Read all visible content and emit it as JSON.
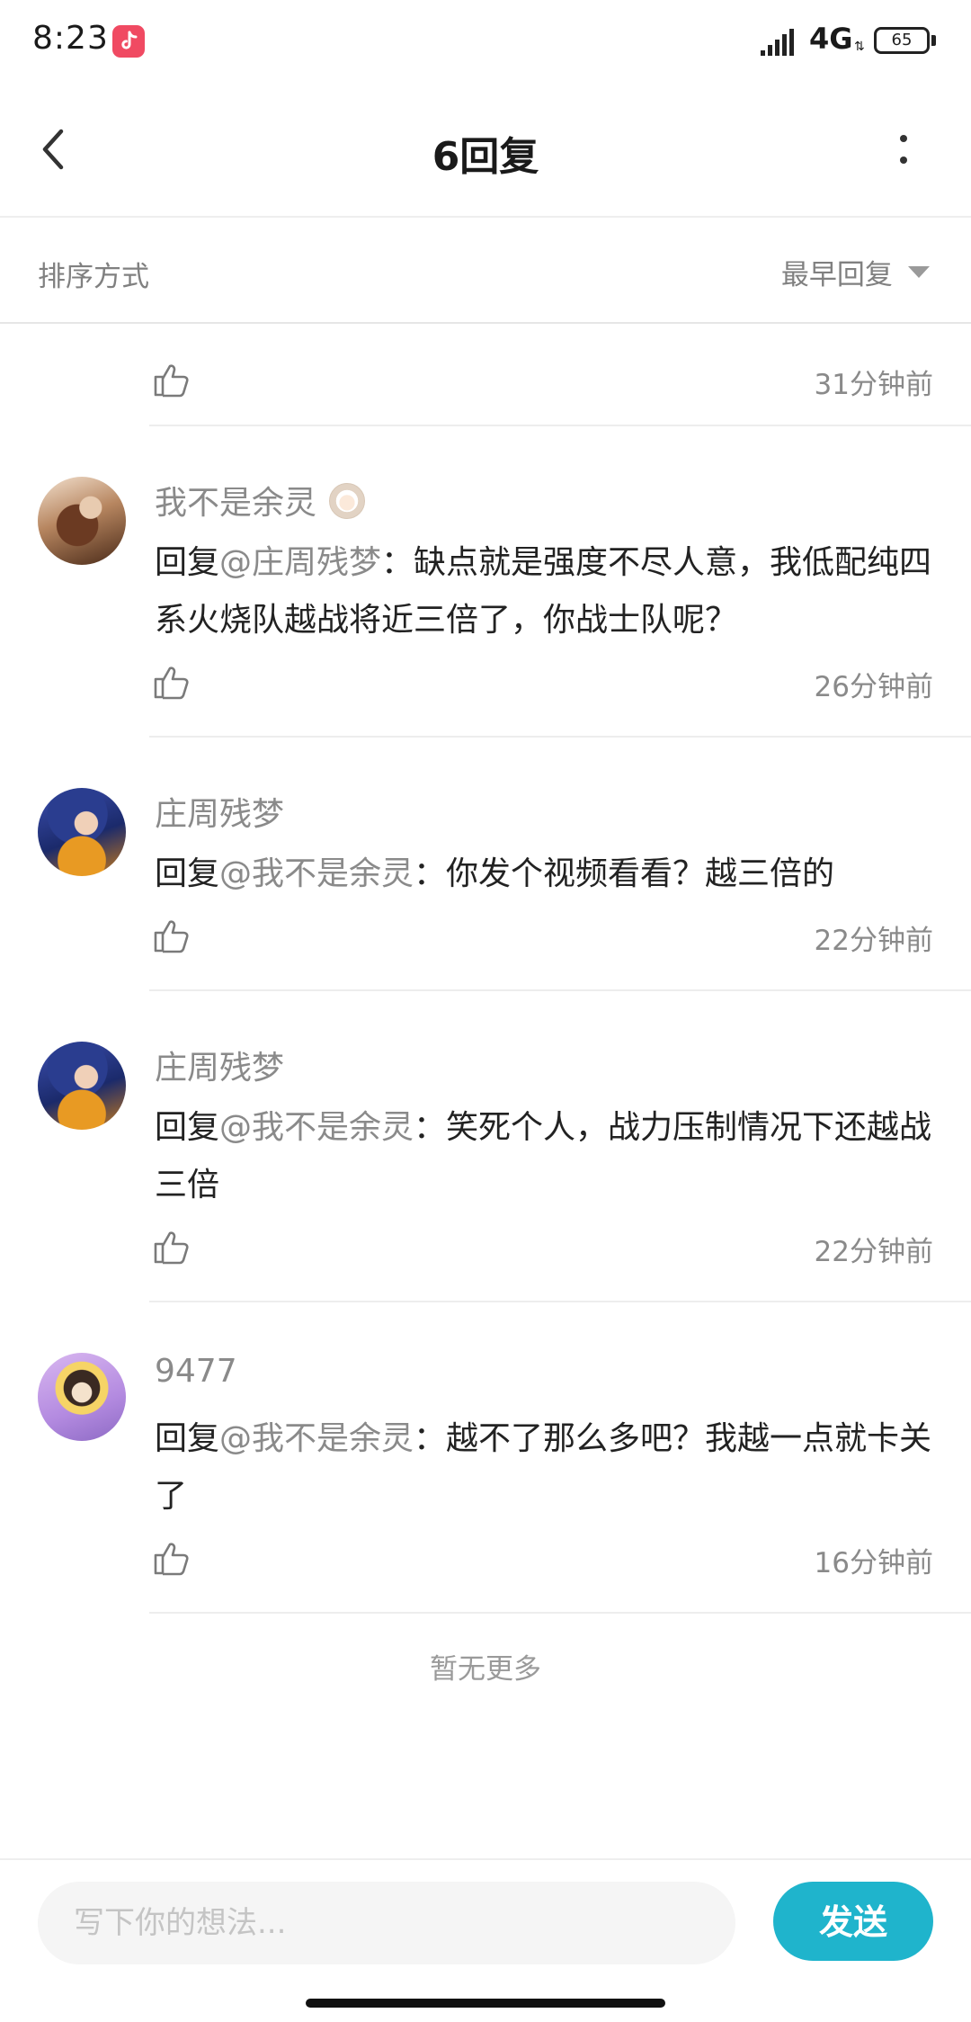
{
  "status_bar": {
    "time": "8:23",
    "network": "4G",
    "battery": "65",
    "icons": [
      "tiktok-icon",
      "signal-icon",
      "battery-icon"
    ]
  },
  "header": {
    "title": "6回复",
    "back_icon": "chevron-left-icon",
    "more_icon": "more-vertical-icon"
  },
  "sort": {
    "label": "排序方式",
    "value": "最早回复"
  },
  "replies": [
    {
      "time": "31分钟前"
    },
    {
      "user": "我不是余灵",
      "prefix": "回复",
      "mention": "@庄周残梦",
      "text": "：缺点就是强度不尽人意，我低配纯四系火烧队越战将近三倍了，你战士队呢？",
      "time": "26分钟前"
    },
    {
      "user": "庄周残梦",
      "prefix": "回复",
      "mention": "@我不是余灵",
      "text": "：你发个视频看看？越三倍的",
      "time": "22分钟前"
    },
    {
      "user": "庄周残梦",
      "prefix": "回复",
      "mention": "@我不是余灵",
      "text": "：笑死个人，战力压制情况下还越战三倍",
      "time": "22分钟前"
    },
    {
      "user": "9477",
      "prefix": "回复",
      "mention": "@我不是余灵",
      "text": "：越不了那么多吧？我越一点就卡关了",
      "time": "16分钟前"
    }
  ],
  "footer_note": "暂无更多",
  "composer": {
    "placeholder": "写下你的想法...",
    "send_label": "发送"
  },
  "colors": {
    "accent": "#1fb4cc",
    "muted_text": "#8a8a8a"
  }
}
